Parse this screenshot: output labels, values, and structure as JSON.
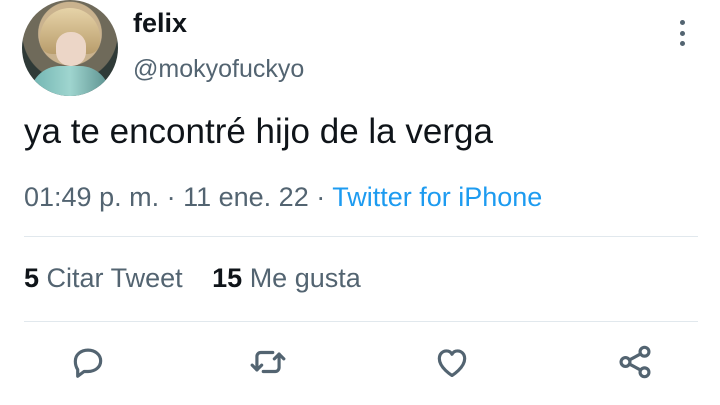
{
  "tweet": {
    "user": {
      "name": "felix",
      "handle": "@mokyofuckyo"
    },
    "text": "ya te encontré hijo de la verga",
    "time": "01:49 p. m.",
    "separator": " · ",
    "date": "11 ene. 22",
    "source": "Twitter for iPhone",
    "stats": {
      "quotes_count": "5",
      "quotes_label": "Citar Tweet",
      "likes_count": "15",
      "likes_label": "Me gusta"
    }
  },
  "icons": [
    "more-vertical-icon",
    "reply-icon",
    "retweet-icon",
    "like-icon",
    "share-icon"
  ],
  "colors": {
    "text_primary": "#0f1419",
    "text_secondary": "#536471",
    "link": "#1d9bf0",
    "divider": "#e1e8ed"
  }
}
